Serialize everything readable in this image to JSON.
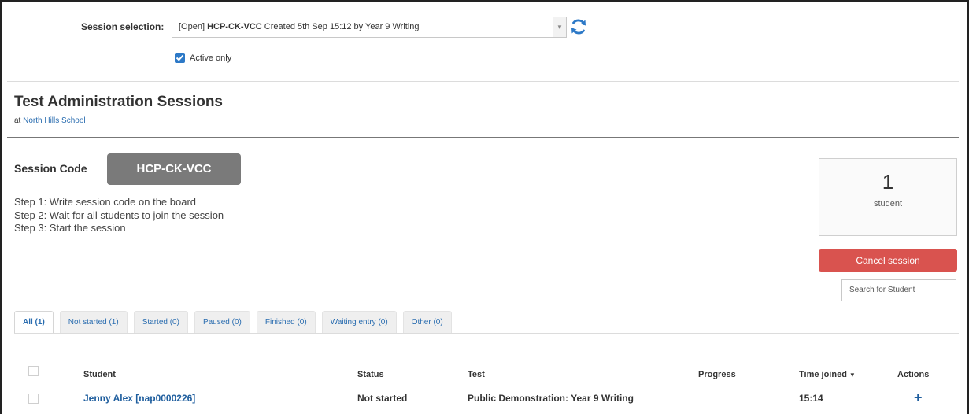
{
  "session": {
    "label": "Session selection:",
    "selected_prefix": "[Open] ",
    "selected_code": "HCP-CK-VCC",
    "selected_suffix": " Created 5th Sep 15:12 by Year 9 Writing",
    "active_only_label": "Active only",
    "active_only_checked": true
  },
  "page": {
    "title": "Test Administration Sessions",
    "at_prefix": "at ",
    "school_link": "North Hills School"
  },
  "session_code": {
    "label": "Session Code",
    "value": "HCP-CK-VCC",
    "steps": [
      "Step 1: Write session code on the board",
      "Step 2: Wait for all students to join the session",
      "Step 3: Start the session"
    ]
  },
  "summary": {
    "count": "1",
    "unit": "student",
    "cancel_label": "Cancel session",
    "search_placeholder": "Search for Student"
  },
  "tabs": [
    {
      "label": "All (1)",
      "active": true
    },
    {
      "label": "Not started (1)",
      "active": false
    },
    {
      "label": "Started (0)",
      "active": false
    },
    {
      "label": "Paused (0)",
      "active": false
    },
    {
      "label": "Finished (0)",
      "active": false
    },
    {
      "label": "Waiting entry (0)",
      "active": false
    },
    {
      "label": "Other (0)",
      "active": false
    }
  ],
  "table": {
    "headers": {
      "student": "Student",
      "status": "Status",
      "test": "Test",
      "progress": "Progress",
      "time_joined": "Time joined",
      "actions": "Actions"
    },
    "rows": [
      {
        "student": "Jenny Alex [nap0000226]",
        "status": "Not started",
        "test": "Public Demonstration: Year 9 Writing",
        "progress": "",
        "time_joined": "15:14",
        "action_icon": "plus-icon"
      }
    ]
  },
  "colors": {
    "accent_blue": "#2a6db0",
    "cancel_red": "#d9534f",
    "code_gray": "#7a7a7a"
  }
}
